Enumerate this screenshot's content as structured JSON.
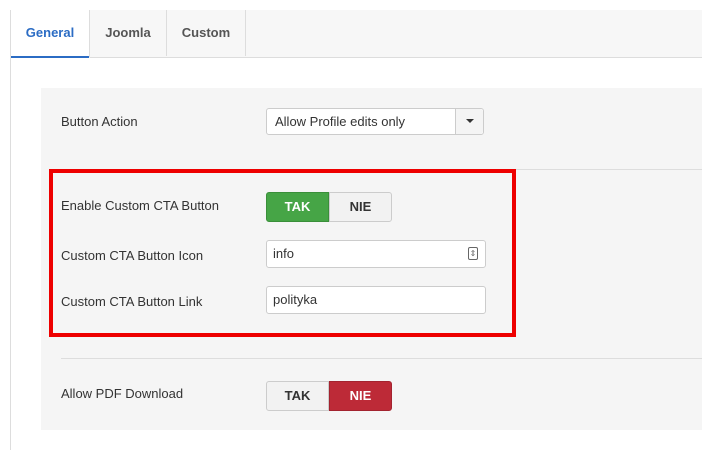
{
  "tabs": [
    {
      "label": "General",
      "active": true
    },
    {
      "label": "Joomla",
      "active": false
    },
    {
      "label": "Custom",
      "active": false
    }
  ],
  "fields": {
    "button_action": {
      "label": "Button Action",
      "selected": "Allow Profile edits only"
    },
    "enable_cta": {
      "label": "Enable Custom CTA Button",
      "yes_label": "TAK",
      "no_label": "NIE",
      "value": "TAK"
    },
    "cta_icon": {
      "label": "Custom CTA Button Icon",
      "value": "info",
      "icon": "picker-icon"
    },
    "cta_link": {
      "label": "Custom CTA Button Link",
      "value": "polityka"
    },
    "allow_pdf": {
      "label": "Allow PDF Download",
      "yes_label": "TAK",
      "no_label": "NIE",
      "value": "NIE"
    }
  },
  "colors": {
    "active_tab": "#2b6cc4",
    "toggle_yes": "#46a546",
    "toggle_no": "#bd2a37",
    "highlight": "#ee0000"
  }
}
